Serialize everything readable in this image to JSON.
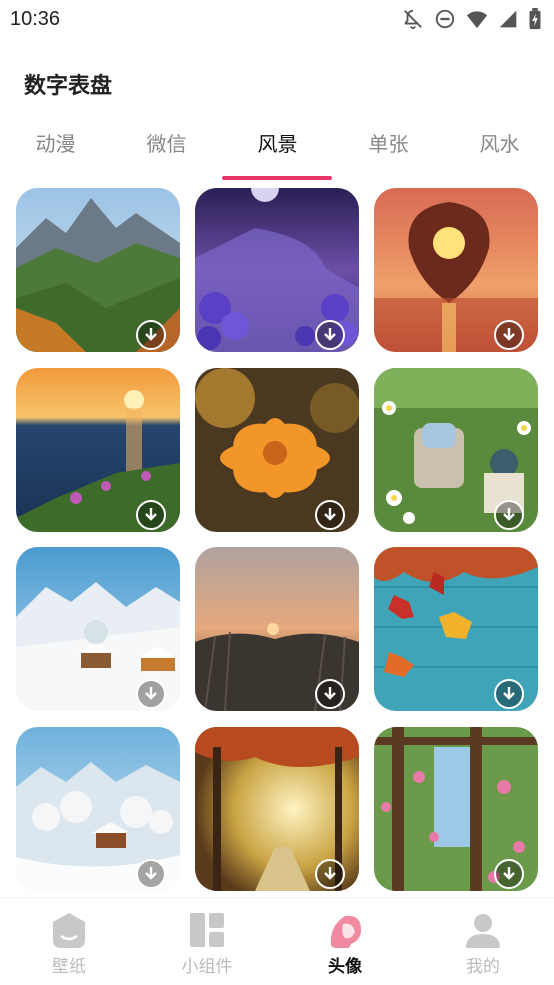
{
  "status_bar": {
    "time": "10:36",
    "icons": [
      "bell-off-icon",
      "dnd-icon",
      "wifi-icon",
      "signal-icon",
      "battery-charging-icon"
    ]
  },
  "page": {
    "title": "数字表盘"
  },
  "tabs": [
    {
      "label": "动漫",
      "active": false
    },
    {
      "label": "微信",
      "active": false
    },
    {
      "label": "风景",
      "active": true
    },
    {
      "label": "单张",
      "active": false
    },
    {
      "label": "风水",
      "active": false
    }
  ],
  "colors": {
    "accent": "#e8366d",
    "inactive_text": "#888888",
    "nav_inactive": "#c8c8c8"
  },
  "wallpapers": [
    {
      "subject": "mountain valley autumn forest",
      "download_icon": "download-icon"
    },
    {
      "subject": "purple roses by night sea with moon",
      "download_icon": "download-icon"
    },
    {
      "subject": "leaf silhouette over sunset sea",
      "download_icon": "download-icon"
    },
    {
      "subject": "sunset over ocean with flowers on cliff",
      "download_icon": "download-icon"
    },
    {
      "subject": "orange flower close-up",
      "download_icon": "download-icon"
    },
    {
      "subject": "garden chair with teapot and daisies",
      "download_icon": "download-icon"
    },
    {
      "subject": "snowy village with mountains",
      "download_icon": "download-icon"
    },
    {
      "subject": "reeds at sunset",
      "download_icon": "download-icon"
    },
    {
      "subject": "autumn leaves on blue wood",
      "download_icon": "download-icon"
    },
    {
      "subject": "snowy cabin in mountains",
      "download_icon": "download-icon"
    },
    {
      "subject": "sunlit autumn forest path",
      "download_icon": "download-icon"
    },
    {
      "subject": "flowered pergola garden",
      "download_icon": "download-icon"
    }
  ],
  "bottom_nav": [
    {
      "label": "壁纸",
      "icon": "wallpaper-icon",
      "active": false
    },
    {
      "label": "小组件",
      "icon": "widget-icon",
      "active": false
    },
    {
      "label": "头像",
      "icon": "avatar-icon",
      "active": true
    },
    {
      "label": "我的",
      "icon": "profile-icon",
      "active": false
    }
  ]
}
